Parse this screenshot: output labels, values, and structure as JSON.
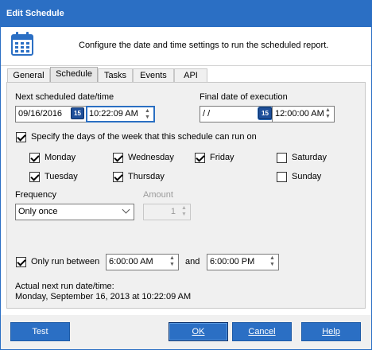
{
  "window": {
    "title": "Edit Schedule"
  },
  "header": {
    "icon": "calendar-icon",
    "text": "Configure the date and time settings to run the scheduled report."
  },
  "tabs": [
    {
      "label": "General",
      "active": false
    },
    {
      "label": "Schedule",
      "active": true
    },
    {
      "label": "Tasks",
      "active": false
    },
    {
      "label": "Events",
      "active": false
    },
    {
      "label": "API",
      "active": false
    }
  ],
  "schedule": {
    "next_label": "Next scheduled date/time",
    "next_date": "09/16/2016",
    "next_time": "10:22:09 AM",
    "final_label": "Final date of execution",
    "final_date": " /  /",
    "final_time": "12:00:00 AM",
    "calendar_button_text": "15",
    "specify_days_label": "Specify the days of the week that this schedule can run on",
    "specify_days_checked": true,
    "days": {
      "monday": {
        "label": "Monday",
        "checked": true
      },
      "tuesday": {
        "label": "Tuesday",
        "checked": true
      },
      "wednesday": {
        "label": "Wednesday",
        "checked": true
      },
      "thursday": {
        "label": "Thursday",
        "checked": true
      },
      "friday": {
        "label": "Friday",
        "checked": true
      },
      "saturday": {
        "label": "Saturday",
        "checked": false
      },
      "sunday": {
        "label": "Sunday",
        "checked": false
      }
    },
    "frequency_label": "Frequency",
    "frequency_value": "Only once",
    "amount_label": "Amount",
    "amount_value": "1",
    "only_run_between_label": "Only run between",
    "only_run_between_checked": true,
    "between_start": "6:00:00 AM",
    "and_label": "and",
    "between_end": "6:00:00 PM",
    "actual_next_label": "Actual next run date/time:",
    "actual_next_value": "Monday, September 16, 2013 at 10:22:09 AM"
  },
  "footer": {
    "test": "Test",
    "ok": "OK",
    "cancel": "Cancel",
    "help": "Help"
  },
  "colors": {
    "accent": "#2b6fc4",
    "focus_border": "#2a6fc2",
    "panel_bg": "#f0f0f0"
  }
}
